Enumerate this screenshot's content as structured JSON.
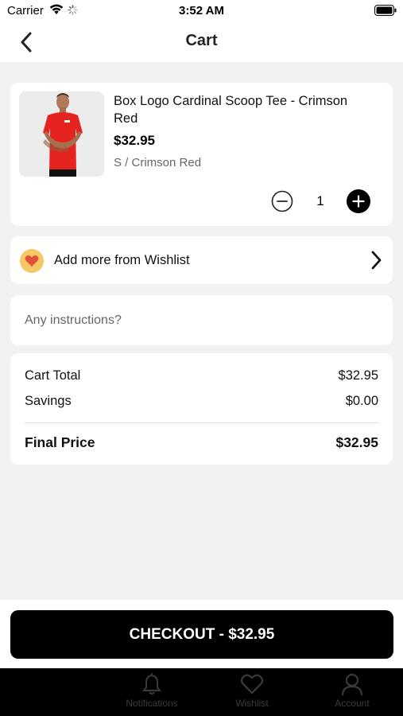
{
  "status_bar": {
    "carrier": "Carrier",
    "time": "3:52 AM"
  },
  "nav": {
    "title": "Cart"
  },
  "cart_item": {
    "name": "Box Logo Cardinal Scoop Tee - Crimson Red",
    "price": "$32.95",
    "variant": "S / Crimson Red",
    "quantity": "1",
    "image_icon": "red-tshirt-model-photo"
  },
  "wishlist": {
    "label": "Add more from Wishlist",
    "icon": "heart-icon",
    "accent_color": "#f4c862",
    "heart_color": "#e0503c"
  },
  "instructions": {
    "placeholder": "Any instructions?"
  },
  "summary": {
    "cart_total_label": "Cart Total",
    "cart_total_value": "$32.95",
    "savings_label": "Savings",
    "savings_value": "$0.00",
    "final_label": "Final Price",
    "final_value": "$32.95"
  },
  "checkout": {
    "label": "CHECKOUT - $32.95"
  },
  "tabs": [
    {
      "label": "Notifications",
      "icon": "bell-icon"
    },
    {
      "label": "Wishlist",
      "icon": "heart-outline-icon"
    },
    {
      "label": "Account",
      "icon": "person-icon"
    }
  ]
}
